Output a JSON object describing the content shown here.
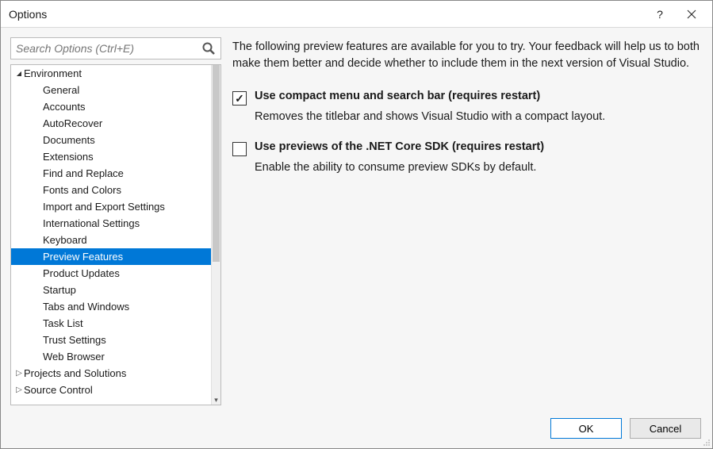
{
  "window": {
    "title": "Options"
  },
  "search": {
    "placeholder": "Search Options (Ctrl+E)"
  },
  "tree": {
    "env_label": "Environment",
    "env_items": [
      "General",
      "Accounts",
      "AutoRecover",
      "Documents",
      "Extensions",
      "Find and Replace",
      "Fonts and Colors",
      "Import and Export Settings",
      "International Settings",
      "Keyboard",
      "Preview Features",
      "Product Updates",
      "Startup",
      "Tabs and Windows",
      "Task List",
      "Trust Settings",
      "Web Browser"
    ],
    "selected": "Preview Features",
    "projects_label": "Projects and Solutions",
    "source_label": "Source Control"
  },
  "content": {
    "intro": "The following preview features are available for you to try. Your feedback will help us to both make them better and decide whether to include them in the next version of Visual Studio.",
    "options": [
      {
        "label": "Use compact menu and search bar (requires restart)",
        "desc": "Removes the titlebar and shows Visual Studio with a compact layout.",
        "checked": true
      },
      {
        "label": "Use previews of the .NET Core SDK (requires restart)",
        "desc": "Enable the ability to consume preview SDKs by default.",
        "checked": false
      }
    ]
  },
  "buttons": {
    "ok": "OK",
    "cancel": "Cancel"
  }
}
